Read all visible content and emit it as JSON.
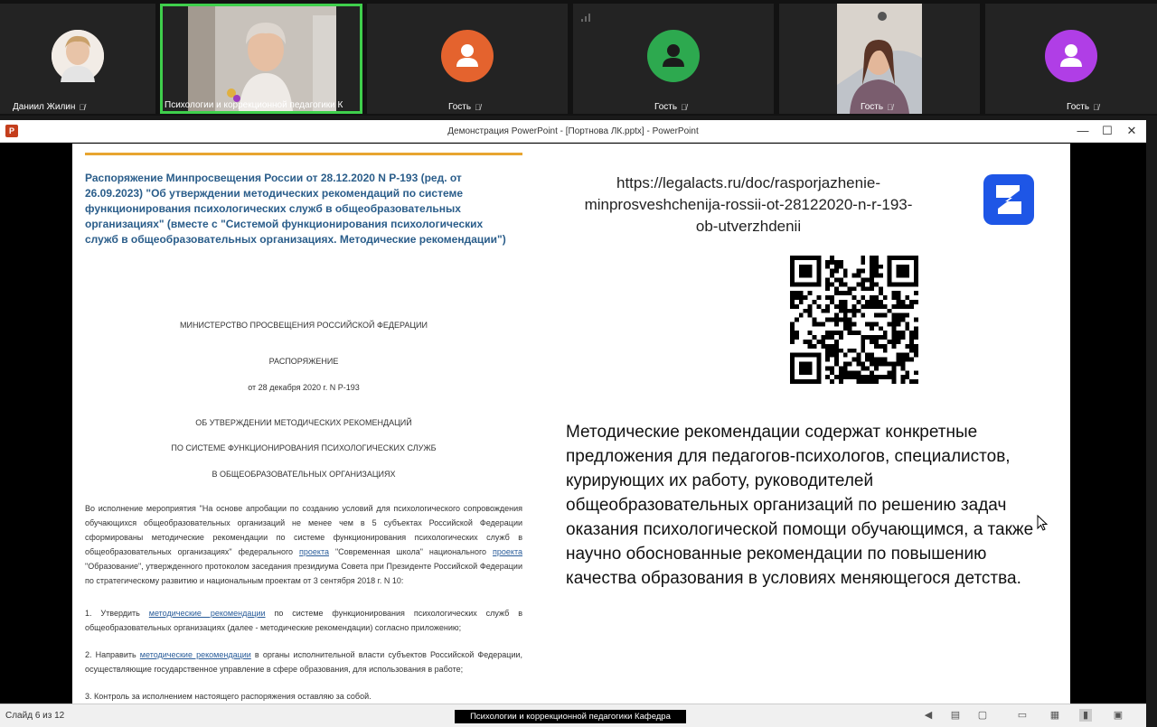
{
  "participants": [
    {
      "name": "Даниил Жилин",
      "type": "photo"
    },
    {
      "name": "Психологии и коррекционной педагогики К",
      "type": "video",
      "active": true
    },
    {
      "name": "Гость",
      "type": "avatar",
      "color": "#e4632e"
    },
    {
      "name": "Гость",
      "type": "avatar",
      "color": "#2da94f"
    },
    {
      "name": "Гость",
      "type": "video"
    },
    {
      "name": "Гость",
      "type": "avatar",
      "color": "#b03ee6"
    }
  ],
  "colors": {
    "active_border": "#3fcf4c",
    "title_blue": "#2a5d8a",
    "rule": "#e8a530",
    "logo": "#1e56e6"
  },
  "window": {
    "title": "Демонстрация PowerPoint - [Портнова ЛК.pptx] - PowerPoint",
    "app_icon": "P",
    "minimize": "—",
    "maximize": "☐",
    "close": "✕"
  },
  "slide": {
    "doc": {
      "title": "Распоряжение Минпросвещения России от 28.12.2020 N Р-193 (ред. от 26.09.2023) \"Об утверждении методических рекомендаций по системе функционирования психологических служб в общеобразовательных организациях\" (вместе с \"Системой функционирования психологических служб в общеобразовательных организациях. Методические рекомендации\")",
      "ministry": "МИНИСТЕРСТВО ПРОСВЕЩЕНИЯ РОССИЙСКОЙ ФЕДЕРАЦИИ",
      "order": "РАСПОРЯЖЕНИЕ",
      "date": "от 28 декабря 2020 г. N Р-193",
      "heading1": "ОБ УТВЕРЖДЕНИИ МЕТОДИЧЕСКИХ РЕКОМЕНДАЦИЙ",
      "heading2": "ПО СИСТЕМЕ ФУНКЦИОНИРОВАНИЯ ПСИХОЛОГИЧЕСКИХ СЛУЖБ",
      "heading3": "В ОБЩЕОБРАЗОВАТЕЛЬНЫХ ОРГАНИЗАЦИЯХ",
      "para1_a": "Во исполнение мероприятия \"На основе апробации по созданию условий для психологического сопровождения обучающихся общеобразовательных организаций не менее чем в 5 субъектах Российской Федерации сформированы методические рекомендации по системе функционирования психологических служб в общеобразовательных организациях\" федерального ",
      "para1_link1": "проекта",
      "para1_b": " \"Современная школа\" национального ",
      "para1_link2": "проекта",
      "para1_c": " \"Образование\", утвержденного протоколом заседания президиума Совета при Президенте Российской Федерации по стратегическому развитию и национальным проектам от 3 сентября 2018 г. N 10:",
      "item1_a": "1. Утвердить ",
      "item1_link": "методические рекомендации",
      "item1_b": " по системе функционирования психологических служб в общеобразовательных организациях (далее - методические рекомендации) согласно приложению;",
      "item2_a": "2. Направить ",
      "item2_link": "методические рекомендации",
      "item2_b": " в органы исполнительной власти субъектов Российской Федерации, осуществляющие государственное управление в сфере образования, для использования в работе;",
      "item3": "3. Контроль за исполнением настоящего распоряжения оставляю за собой."
    },
    "url_line1": "https://legalacts.ru/doc/rasporjazhenie-",
    "url_line2": "minprosveshchenija-rossii-ot-28122020-n-r-193-",
    "url_line3": "ob-utverzhdenii",
    "description": "Методические рекомендации содержат конкретные предложения для педагогов-психологов, специалистов, курирующих их работу, руководителей общеобразовательных организаций по решению задач оказания психологической помощи обучающимся, а также научно обоснованные рекомендации по повышению качества образования в условиях меняющегося детства."
  },
  "statusbar": {
    "slide_info": "Слайд 6 из 12",
    "caption": "Психологии и коррекционной педагогики Кафедра"
  }
}
